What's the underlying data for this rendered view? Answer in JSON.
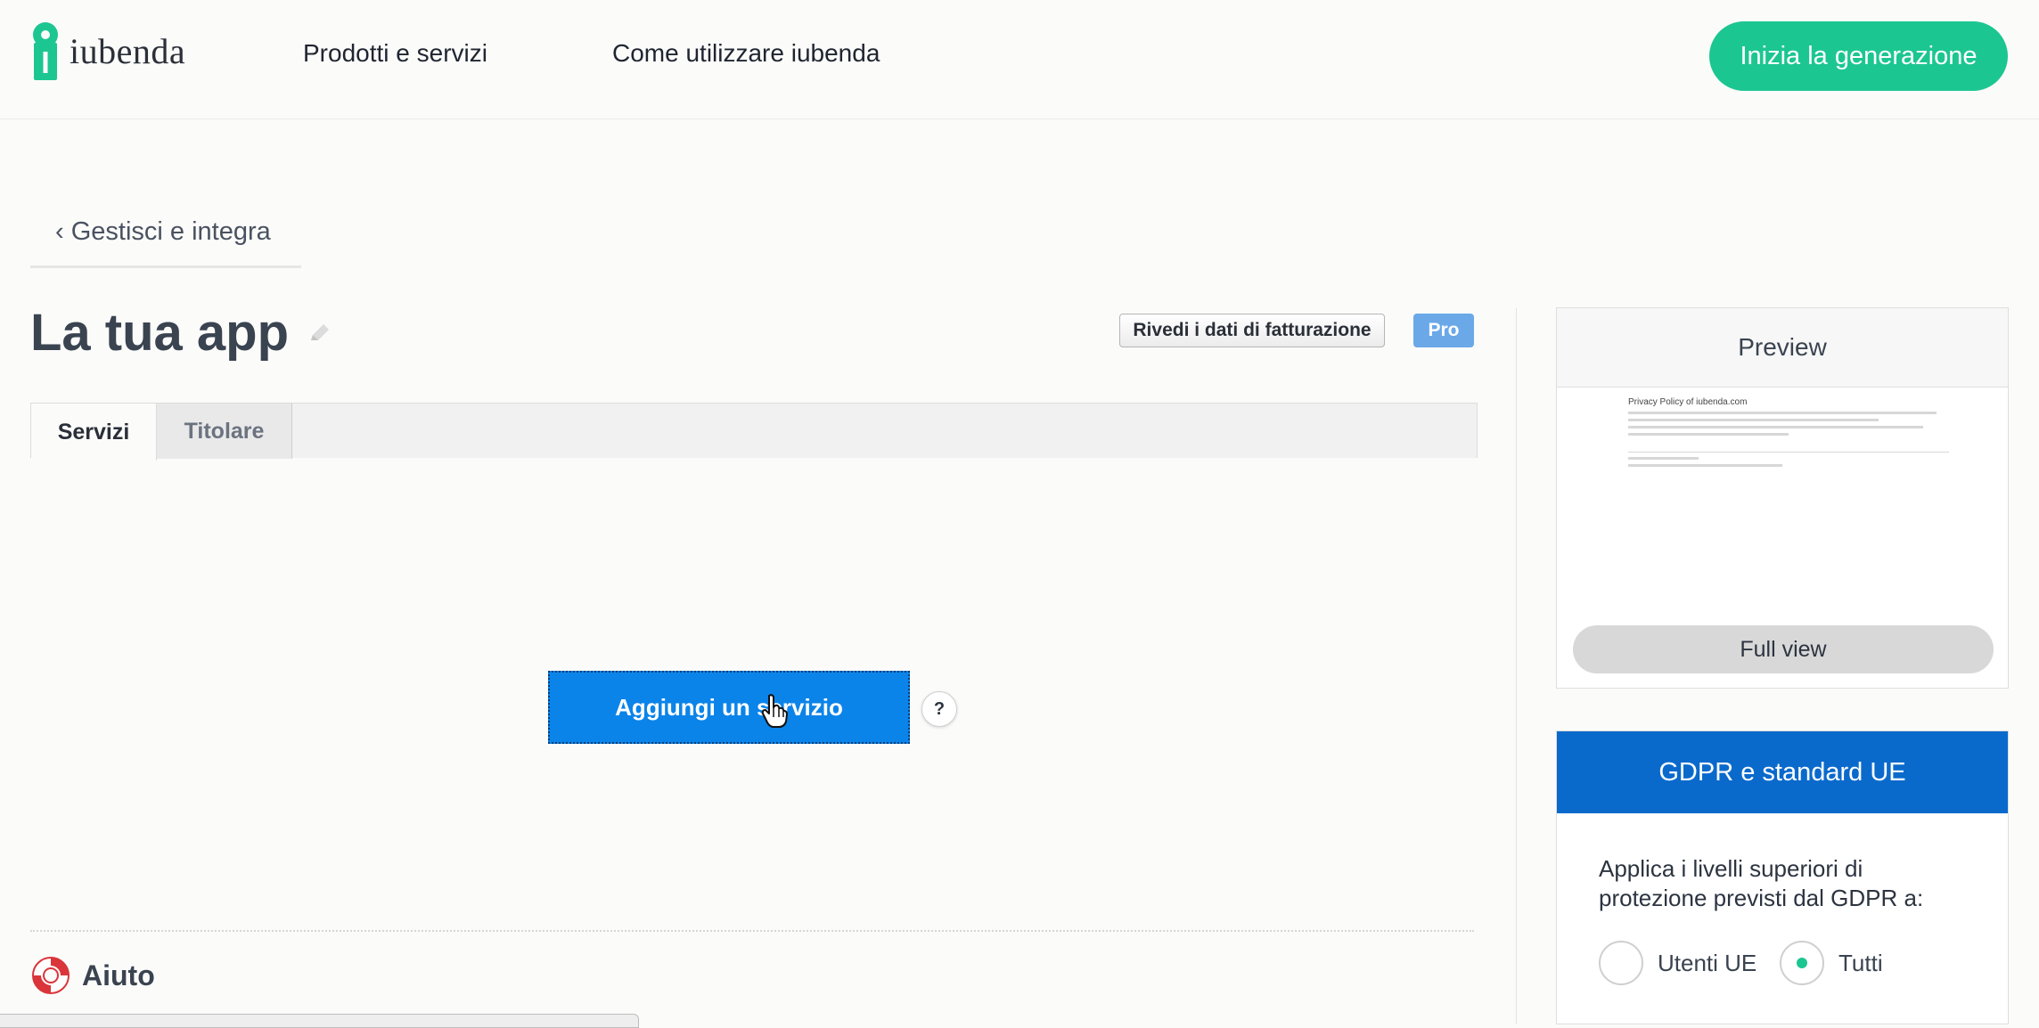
{
  "header": {
    "logo_text": "iubenda",
    "nav": [
      "Prodotti e servizi",
      "Come utilizzare iubenda"
    ],
    "cta_label": "Inizia la generazione",
    "brand_color": "#1cc691"
  },
  "back_link": "‹ Gestisci e integra",
  "page_title": "La tua app",
  "billing_button": "Rivedi i dati di fatturazione",
  "plan_badge": "Pro",
  "tabs": [
    {
      "label": "Servizi",
      "active": true
    },
    {
      "label": "Titolare",
      "active": false
    }
  ],
  "main": {
    "add_service_label": "Aggiungi un servizio",
    "help_mark": "?",
    "help_section_label": "Aiuto"
  },
  "preview": {
    "heading": "Preview",
    "doc_title": "Privacy Policy of iubenda.com",
    "full_view_label": "Full view"
  },
  "gdpr": {
    "heading": "GDPR e standard UE",
    "description": "Applica i livelli superiori di protezione previsti dal GDPR a:",
    "options": [
      {
        "label": "Utenti UE",
        "selected": false
      },
      {
        "label": "Tutti",
        "selected": true
      }
    ],
    "accent_color": "#0a6acc"
  },
  "icons": [
    "iubenda-keyhole-logo-icon",
    "pencil-icon",
    "hand-pointer-cursor-icon",
    "lifebuoy-icon"
  ]
}
